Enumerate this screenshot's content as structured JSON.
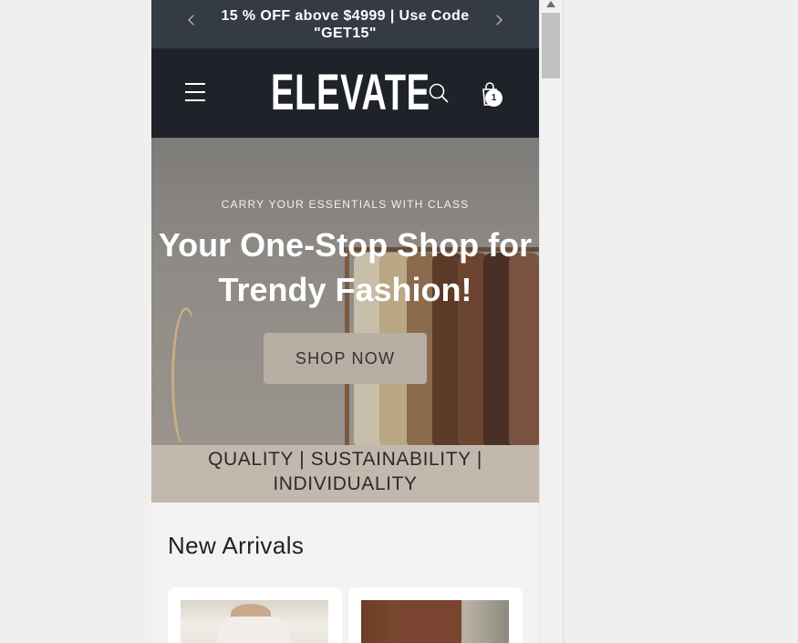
{
  "announcement": {
    "text": "15 % OFF above $4999 | Use Code \"GET15\""
  },
  "header": {
    "logo": "ELEVATE",
    "cart_count": "1",
    "icons": [
      "menu-icon",
      "search-icon",
      "cart-icon"
    ]
  },
  "hero": {
    "eyebrow": "CARRY YOUR ESSENTIALS WITH CLASS",
    "title": "Your One-Stop Shop for Trendy Fashion!",
    "cta": "SHOP NOW"
  },
  "values_strip": {
    "text": "QUALITY | SUSTAINABILITY | INDIVIDUALITY"
  },
  "new_arrivals": {
    "title": "New Arrivals"
  },
  "colors": {
    "announcement_bg": "#343b45",
    "header_bg": "#1f2329",
    "cta_bg": "#b8aea3",
    "values_bg": "#c3b8ae"
  }
}
